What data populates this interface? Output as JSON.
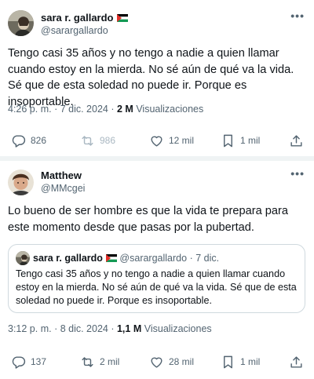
{
  "tweet1": {
    "author_name": "sara r. gallardo",
    "author_handle": "@sarargallardo",
    "text": "Tengo casi 35 años y no tengo a nadie a quien llamar cuando estoy en la mierda. No sé aún de qué va la vida. Sé que de esta soledad no puede ir. Porque es insoportable.",
    "time": "4:26 p. m.",
    "date": "7 dic. 2024",
    "views_count": "2 M",
    "views_label": "Visualizaciones",
    "replies": "826",
    "reposts": "986",
    "likes": "12 mil",
    "bookmarks": "1 mil"
  },
  "tweet2": {
    "author_name": "Matthew",
    "author_handle": "@MMcgei",
    "text": "Lo bueno de ser hombre es que la vida te prepara para este momento desde que pasas por la pubertad.",
    "quoted": {
      "author_name": "sara r. gallardo",
      "author_handle": "@sarargallardo",
      "date": "7 dic.",
      "text": "Tengo casi 35 años y no tengo a nadie a quien llamar cuando estoy en la mierda. No sé aún de qué va la vida. Sé que de esta soledad no puede ir. Porque es insoportable."
    },
    "time": "3:12 p. m.",
    "date": "8 dic. 2024",
    "views_count": "1,1 M",
    "views_label": "Visualizaciones",
    "replies": "137",
    "reposts": "2 mil",
    "likes": "28 mil",
    "bookmarks": "1 mil"
  },
  "icons": {
    "more": "more-icon",
    "reply": "reply-icon",
    "repost": "repost-icon",
    "like": "like-icon",
    "bookmark": "bookmark-icon",
    "share": "share-icon",
    "flag": "palestine-flag-icon"
  },
  "colors": {
    "text_primary": "#0f1419",
    "text_secondary": "#536471",
    "border": "#cfd9de",
    "divider": "#eff3f4"
  }
}
